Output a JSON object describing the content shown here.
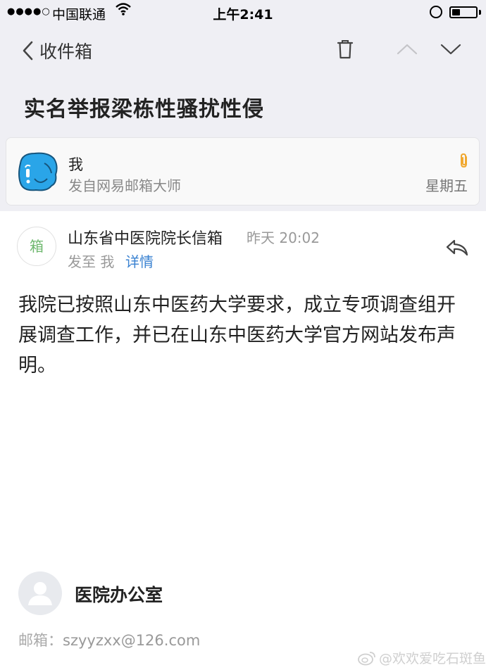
{
  "status_bar": {
    "signal": "●●●●○",
    "carrier": "中国联通",
    "time": "上午2:41",
    "battery_level": 0.35
  },
  "nav": {
    "back_label": "收件箱",
    "icons": [
      "trash-icon",
      "chevron-up-icon",
      "chevron-down-icon"
    ]
  },
  "subject": "实名举报梁栋性骚扰性侵",
  "thread_card": {
    "sender": "我",
    "via": "发自网易邮箱大师",
    "day": "星期五",
    "attachment_icon": "paperclip-icon"
  },
  "message": {
    "sender_avatar_text": "箱",
    "sender_name": "山东省中医院院长信箱",
    "sent_time": "昨天 20:02",
    "sent_to": "发至 我",
    "details_label": "详情",
    "body": "我院已按照山东中医药大学要求，成立专项调查组开展调查工作，并已在山东中医药大学官方网站发布声明。"
  },
  "signature": {
    "name": "医院办公室",
    "email_label": "邮箱：",
    "email": "szyyzxx@126.com"
  },
  "watermark": "@欢欢爱吃石斑鱼",
  "colors": {
    "header_bg": "#efeff4",
    "link": "#3a82d1",
    "avatar_blue": "#2aa5e8",
    "clip_orange": "#f0a830",
    "avatar_text_green": "#6fb86f"
  }
}
